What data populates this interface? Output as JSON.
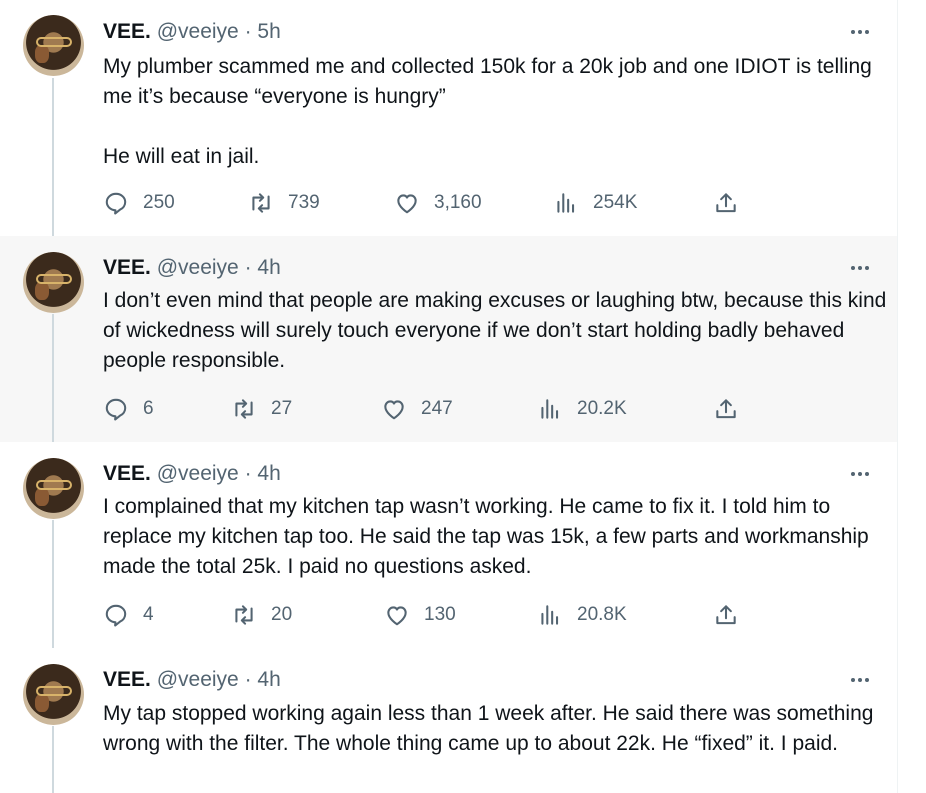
{
  "tweets": [
    {
      "name": "VEE.",
      "handle": "@veeiye",
      "sep": " · ",
      "time": "5h",
      "text": "My plumber scammed me and collected 150k for a 20k job and one IDIOT is telling me it’s because “everyone is hungry”\n\nHe will eat in jail.",
      "replies": "250",
      "reposts": "739",
      "likes": "3,160",
      "views": "254K"
    },
    {
      "name": "VEE.",
      "handle": "@veeiye",
      "sep": " · ",
      "time": "4h",
      "text": "I don’t even mind that people are making excuses or laughing btw, because this kind of wickedness will surely touch everyone if we don’t start holding badly behaved people responsible.",
      "replies": "6",
      "reposts": "27",
      "likes": "247",
      "views": "20.2K"
    },
    {
      "name": "VEE.",
      "handle": "@veeiye",
      "sep": " · ",
      "time": "4h",
      "text": "I complained that my kitchen tap wasn’t working. He came to fix it. I told him to replace my kitchen tap too. He said the tap was 15k, a few parts and workmanship made the total 25k. I paid no questions asked.",
      "replies": "4",
      "reposts": "20",
      "likes": "130",
      "views": "20.8K"
    },
    {
      "name": "VEE.",
      "handle": "@veeiye",
      "sep": " · ",
      "time": "4h",
      "text": "My tap stopped working again less than 1 week after. He said there was something wrong with the filter. The whole thing came up to about 22k. He “fixed” it. I paid."
    }
  ],
  "icons": {
    "reply": "reply-icon",
    "repost": "repost-icon",
    "like": "like-icon",
    "views": "views-icon",
    "share": "share-icon",
    "more": "more-icon"
  },
  "colors": {
    "muted": "#536471",
    "text": "#0f1419",
    "thread_line": "#cfd9de",
    "highlight_bg": "#f7f7f7"
  }
}
